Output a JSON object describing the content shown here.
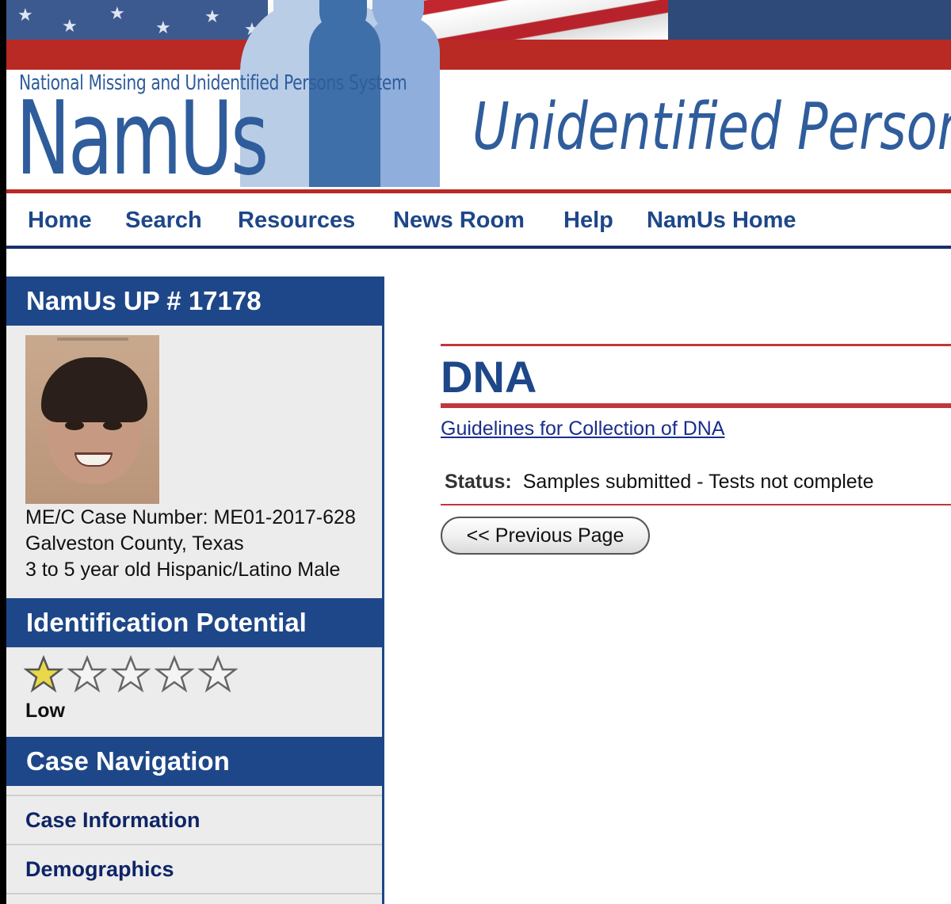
{
  "banner": {
    "system_name": "National Missing and Unidentified Persons System",
    "logo_text": "NamUs",
    "section_heading": "Unidentified Persons"
  },
  "topnav": {
    "items": [
      "Home",
      "Search",
      "Resources",
      "News Room",
      "Help",
      "NamUs Home"
    ]
  },
  "sidebar": {
    "case_heading": "NamUs UP # 17178",
    "case_lines": [
      "ME/C Case Number: ME01-2017-628",
      "Galveston County, Texas",
      "3 to 5 year old Hispanic/Latino Male"
    ],
    "identification_heading": "Identification Potential",
    "rating": {
      "value": 1,
      "max": 5,
      "label": "Low"
    },
    "star_colors": {
      "filled": "#e8d84a",
      "empty": "#f4f4f4"
    },
    "case_navigation_heading": "Case Navigation",
    "nav_items": [
      "Case Information",
      "Demographics"
    ]
  },
  "main": {
    "title": "DNA",
    "guidelines_link": "Guidelines for Collection of DNA",
    "status_label": "Status:",
    "status_value": "Samples submitted - Tests not complete",
    "previous_button": "<< Previous Page"
  },
  "colors": {
    "brand_blue": "#1e4789",
    "accent_red": "#c0373b",
    "sidebar_bg": "#ececec"
  }
}
